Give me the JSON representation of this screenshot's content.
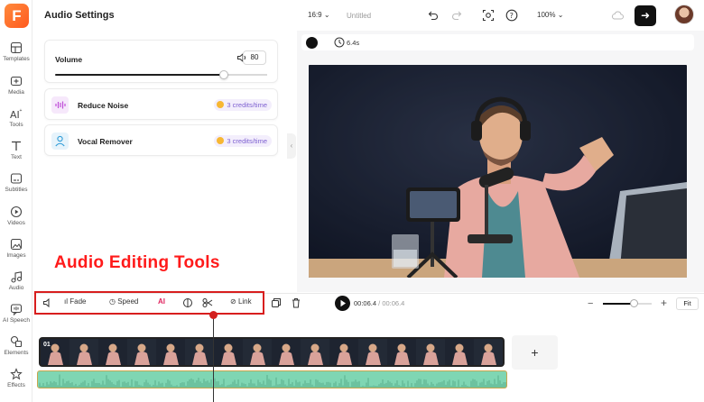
{
  "nav": {
    "logo": "F",
    "items": [
      {
        "label": "Templates",
        "icon": "templates-icon"
      },
      {
        "label": "Media",
        "icon": "media-icon"
      },
      {
        "label": "Tools",
        "icon": "ai-tools-icon"
      },
      {
        "label": "Text",
        "icon": "text-icon"
      },
      {
        "label": "Subtitles",
        "icon": "subtitles-icon"
      },
      {
        "label": "Videos",
        "icon": "videos-icon"
      },
      {
        "label": "Images",
        "icon": "images-icon"
      },
      {
        "label": "Audio",
        "icon": "audio-icon"
      },
      {
        "label": "AI Speech",
        "icon": "ai-speech-icon"
      },
      {
        "label": "Elements",
        "icon": "elements-icon"
      },
      {
        "label": "Effects",
        "icon": "effects-icon"
      }
    ]
  },
  "panel": {
    "title": "Audio Settings",
    "volume_label": "Volume",
    "volume_value": "80",
    "volume_level": 0.8,
    "features": [
      {
        "label": "Reduce Noise",
        "credits": "3 credits/time",
        "icon": "waveform-icon",
        "color": "#f6e8fb"
      },
      {
        "label": "Vocal Remover",
        "credits": "3 credits/time",
        "icon": "person-icon",
        "color": "#e6f3fb"
      }
    ]
  },
  "topbar": {
    "aspect": "16:9",
    "project_name": "Untitled",
    "zoom": "100%"
  },
  "canvas": {
    "duration": "6.4s"
  },
  "timeline": {
    "tools": {
      "fade": "Fade",
      "speed": "Speed",
      "ai": "AI",
      "link": "Link"
    },
    "current_time": "00:06.4",
    "separator": "/",
    "total_time": "00:06.4",
    "fit": "Fit",
    "clip_index": "01",
    "add": "+"
  },
  "overlay": {
    "title": "Audio Editing Tools"
  },
  "colors": {
    "accent": "#ff5a1f",
    "highlight_box": "#d81e1e",
    "audio_track": "#7fd6b3",
    "credits_text": "#7d5fd0"
  }
}
